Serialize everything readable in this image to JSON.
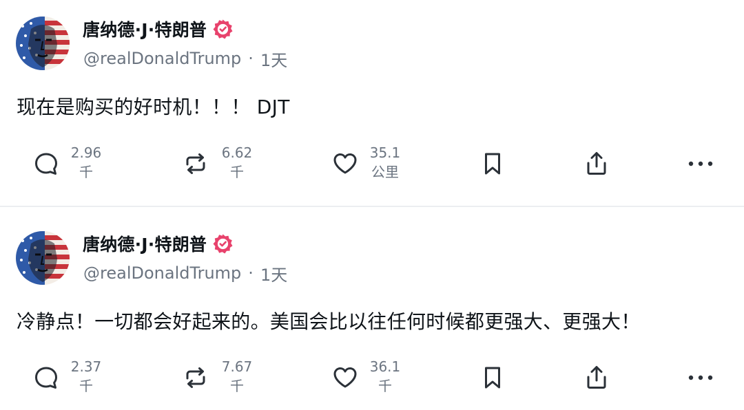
{
  "colors": {
    "text": "#0f1419",
    "muted": "#6b7480",
    "verified_badge": "#e8426c",
    "divider": "#eceef1"
  },
  "posts": [
    {
      "author": {
        "display_name": "唐纳德·J·特朗普",
        "handle": "@realDonaldTrump",
        "verified_icon": "verified-badge-icon",
        "avatar": "profile-avatar"
      },
      "separator": "·",
      "time": "1天",
      "text": "现在是购买的好时机！！！ DJT",
      "actions": {
        "reply": {
          "icon": "reply-icon",
          "count_line1": "2.96",
          "count_line2": "千"
        },
        "repost": {
          "icon": "repost-icon",
          "count_line1": "6.62",
          "count_line2": "千"
        },
        "like": {
          "icon": "heart-icon",
          "count_line1": "35.1",
          "count_line2": "公里"
        },
        "bookmark": {
          "icon": "bookmark-icon"
        },
        "share": {
          "icon": "share-icon"
        },
        "more": {
          "icon": "more-icon"
        }
      }
    },
    {
      "author": {
        "display_name": "唐纳德·J·特朗普",
        "handle": "@realDonaldTrump",
        "verified_icon": "verified-badge-icon",
        "avatar": "profile-avatar"
      },
      "separator": "·",
      "time": "1天",
      "text": "冷静点！一切都会好起来的。美国会比以往任何时候都更强大、更强大！",
      "actions": {
        "reply": {
          "icon": "reply-icon",
          "count_line1": "2.37",
          "count_line2": "千"
        },
        "repost": {
          "icon": "repost-icon",
          "count_line1": "7.67",
          "count_line2": "千"
        },
        "like": {
          "icon": "heart-icon",
          "count_line1": "36.1",
          "count_line2": "千"
        },
        "bookmark": {
          "icon": "bookmark-icon"
        },
        "share": {
          "icon": "share-icon"
        },
        "more": {
          "icon": "more-icon"
        }
      }
    }
  ]
}
